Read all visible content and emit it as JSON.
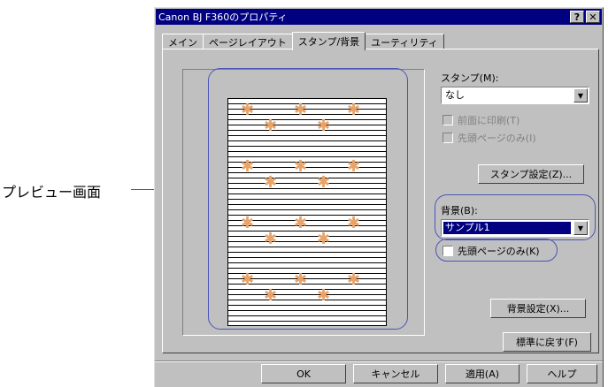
{
  "callout": {
    "label": "プレビュー画面"
  },
  "window": {
    "title": "Canon BJ F360のプロパティ",
    "help_button": "?",
    "close_button": "✕"
  },
  "tabs": [
    {
      "label": "メイン",
      "active": false
    },
    {
      "label": "ページレイアウト",
      "active": false
    },
    {
      "label": "スタンプ/背景",
      "active": true
    },
    {
      "label": "ユーティリティ",
      "active": false
    }
  ],
  "stamp": {
    "label": "スタンプ(M):",
    "value": "なし",
    "front_print_label": "前面に印刷(T)",
    "first_page_only_label": "先頭ページのみ(I)",
    "settings_button": "スタンプ設定(Z)..."
  },
  "background": {
    "label": "背景(B):",
    "value": "サンプル1",
    "first_page_only_label": "先頭ページのみ(K)",
    "settings_button": "背景設定(X)..."
  },
  "defaults_button": "標準に戻す(F)",
  "footer": {
    "ok": "OK",
    "cancel": "キャンセル",
    "apply": "適用(A)",
    "help": "ヘルプ"
  },
  "colors": {
    "highlight": "#4a55b6",
    "title_bar": "#000080",
    "watermark": "#e8a36a"
  },
  "icons": {
    "dropdown_arrow": "▼",
    "watermark_mark": "✱"
  }
}
